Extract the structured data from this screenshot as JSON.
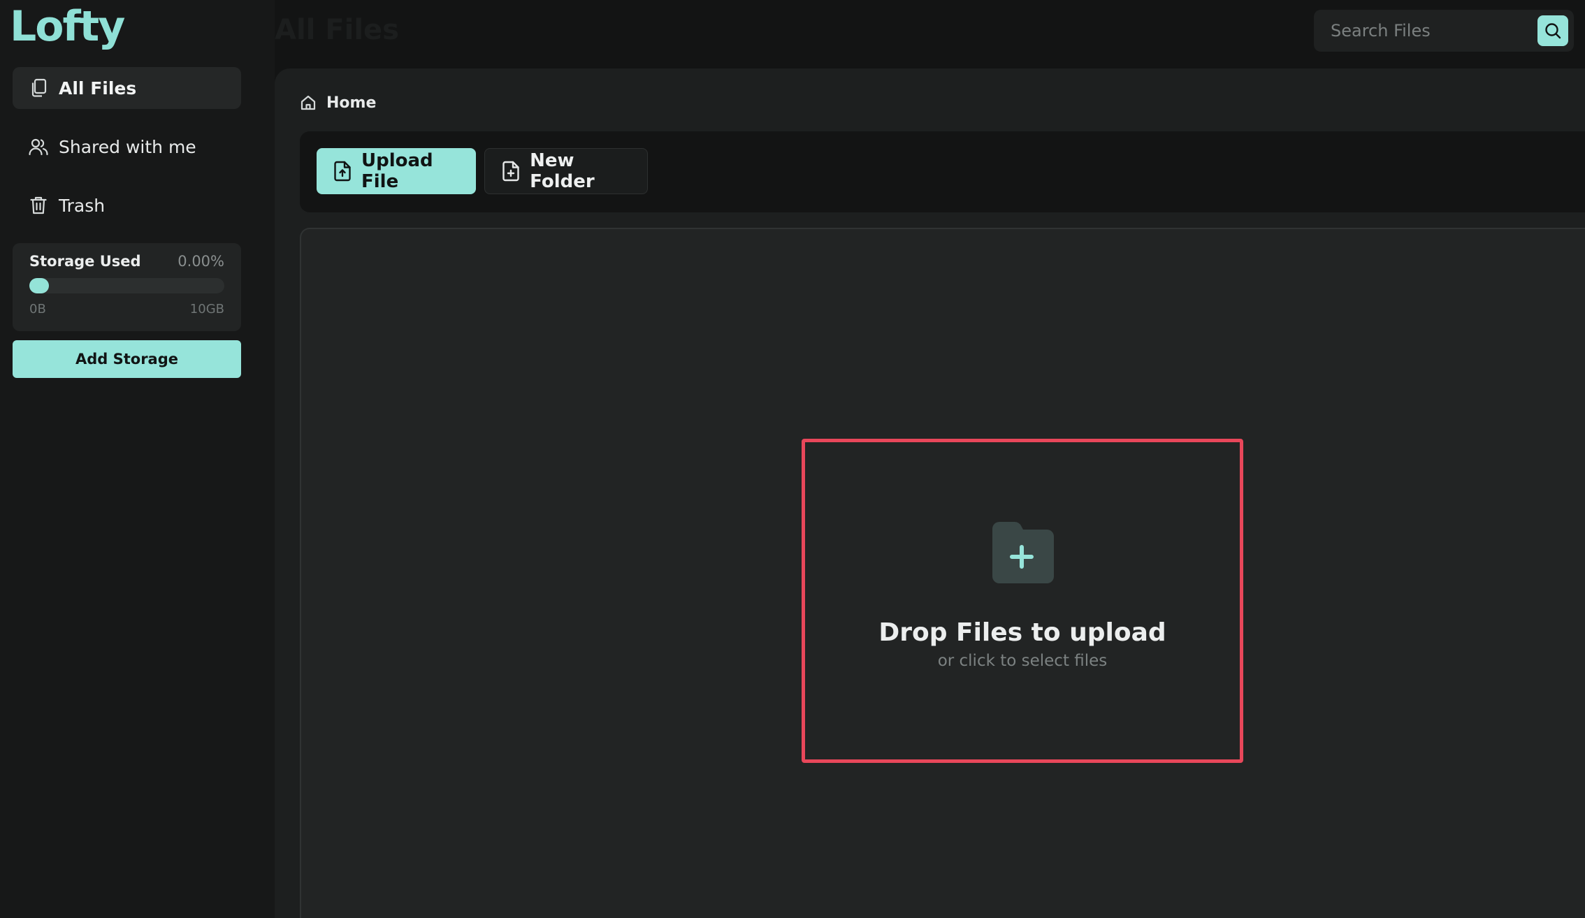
{
  "app": {
    "logo": "Lofty",
    "page_title": "All Files"
  },
  "sidebar": {
    "items": [
      {
        "label": "All Files",
        "icon": "files-icon",
        "active": true
      },
      {
        "label": "Shared with me",
        "icon": "users-icon",
        "active": false
      },
      {
        "label": "Trash",
        "icon": "trash-icon",
        "active": false
      }
    ],
    "storage": {
      "title": "Storage Used",
      "percent_text": "0.00%",
      "used_fraction": 0.0,
      "min_label": "0B",
      "max_label": "10GB"
    },
    "add_storage_label": "Add Storage"
  },
  "search": {
    "placeholder": "Search Files",
    "value": "",
    "icon": "search-icon"
  },
  "breadcrumb": {
    "label": "Home",
    "icon": "home-icon"
  },
  "toolbar": {
    "upload_label": "Upload File",
    "upload_icon": "file-upload-icon",
    "new_folder_label": "New Folder",
    "new_folder_icon": "file-plus-icon"
  },
  "dropzone": {
    "title": "Drop Files to upload",
    "subtitle": "or click to select files",
    "icon": "folder-plus-icon"
  },
  "colors": {
    "accent": "#96e4da",
    "background": "#131414",
    "panel": "#1d1f1f",
    "dropzone_border": "#e8475a"
  }
}
